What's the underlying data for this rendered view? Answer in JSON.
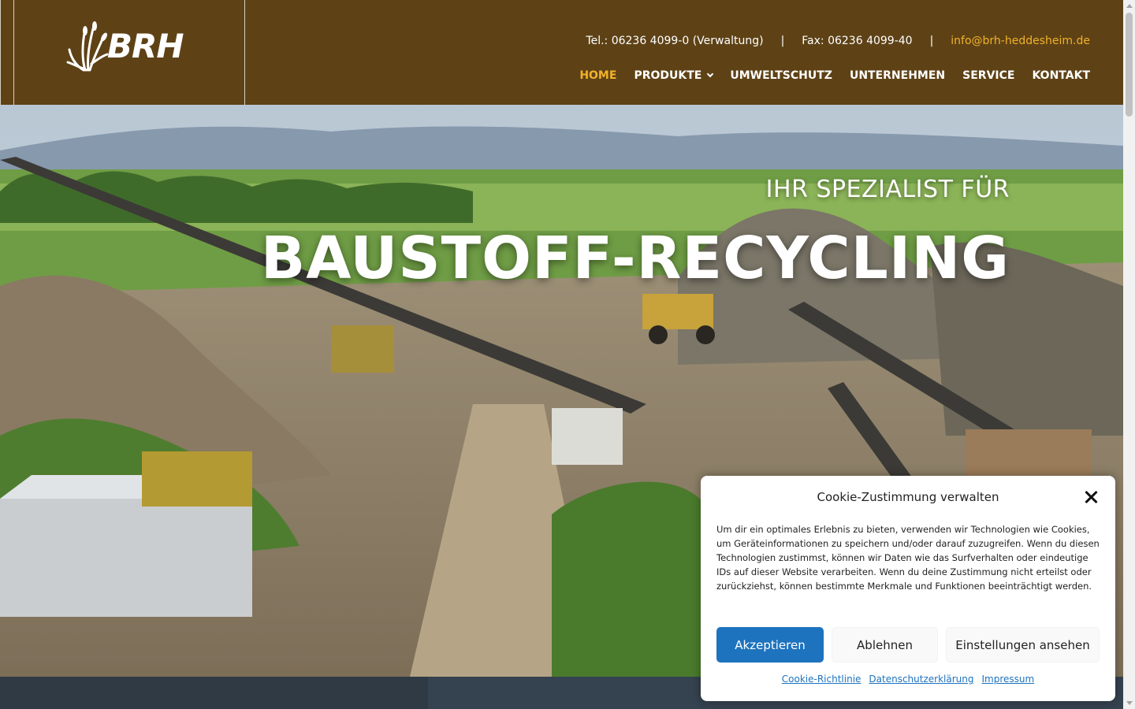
{
  "brand": {
    "logo_text": "BRH"
  },
  "topbar": {
    "phone": "Tel.: 06236 4099-0 (Verwaltung)",
    "separator": "|",
    "fax": "Fax: 06236 4099-40",
    "email": "info@brh-heddesheim.de"
  },
  "nav": {
    "items": [
      {
        "label": "HOME",
        "active": true
      },
      {
        "label": "PRODUKTE",
        "has_dropdown": true
      },
      {
        "label": "UMWELTSCHUTZ"
      },
      {
        "label": "UNTERNEHMEN"
      },
      {
        "label": "SERVICE"
      },
      {
        "label": "KONTAKT"
      }
    ]
  },
  "hero": {
    "subtitle": "IHR SPEZIALIST FÜR",
    "title": "BAUSTOFF-RECYCLING"
  },
  "cookie": {
    "title": "Cookie-Zustimmung verwalten",
    "text": "Um dir ein optimales Erlebnis zu bieten, verwenden wir Technologien wie Cookies, um Geräteinformationen zu speichern und/oder darauf zuzugreifen. Wenn du diesen Technologien zustimmst, können wir Daten wie das Surfverhalten oder eindeutige IDs auf dieser Website verarbeiten. Wenn du deine Zustimmung nicht erteilst oder zurückziehst, können bestimmte Merkmale und Funktionen beeinträchtigt werden.",
    "accept": "Akzeptieren",
    "deny": "Ablehnen",
    "settings": "Einstellungen ansehen",
    "links": [
      "Cookie-Richtlinie",
      "Datenschutzerklärung",
      "Impressum"
    ]
  },
  "colors": {
    "header_bg": "#5e4216",
    "accent": "#f1b12a",
    "primary_button": "#1e73be"
  }
}
